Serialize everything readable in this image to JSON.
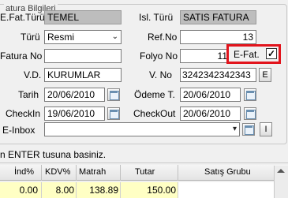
{
  "group_title": "atura Bilgileri",
  "fields": {
    "efat_turu": {
      "label": "E.Fat.Türü",
      "value": "TEMEL"
    },
    "isl_turu": {
      "label": "Isl. Türü",
      "value": "SATIS FATURA"
    },
    "turu": {
      "label": "Türü",
      "value": "Resmi"
    },
    "ref_no": {
      "label": "Ref.No",
      "value": "13"
    },
    "fatura_no": {
      "label": "Fatura No",
      "value": ""
    },
    "folyo_no": {
      "label": "Folyo No",
      "value": "11"
    },
    "efat": {
      "label": "E-Fat.",
      "checked_mark": "✓"
    },
    "vd": {
      "label": "V.D.",
      "value": "KURUMLAR"
    },
    "vno": {
      "label": "V. No",
      "value": "3242342342343"
    },
    "vno_btn": "E",
    "tarih": {
      "label": "Tarih",
      "value": "20/06/2010"
    },
    "odeme": {
      "label": "Ödeme T.",
      "value": "20/06/2010"
    },
    "checkin": {
      "label": "CheckIn",
      "value": "19/06/2010"
    },
    "checkout": {
      "label": "CheckOut",
      "value": "20/06/2010"
    },
    "einbox": {
      "label": "E-Inbox",
      "value": "",
      "btn": "I"
    }
  },
  "status_text": "n ENTER tusuna basiniz.",
  "grid": {
    "headers": [
      "İnd%",
      "KDV%",
      "Matrah",
      "Tutar",
      "Satış Grubu"
    ],
    "row": [
      "0.00",
      "8.00",
      "138.89",
      "150.00",
      ""
    ]
  },
  "colors": {
    "highlight_border": "#e2141c",
    "row_yellow": "#ffffc4",
    "readonly_gray": "#bdbdbd"
  },
  "icons": {
    "calendar": "calendar-icon",
    "combo_arrow": "chevron-down-icon",
    "scroll_up": "arrow-up-icon"
  }
}
